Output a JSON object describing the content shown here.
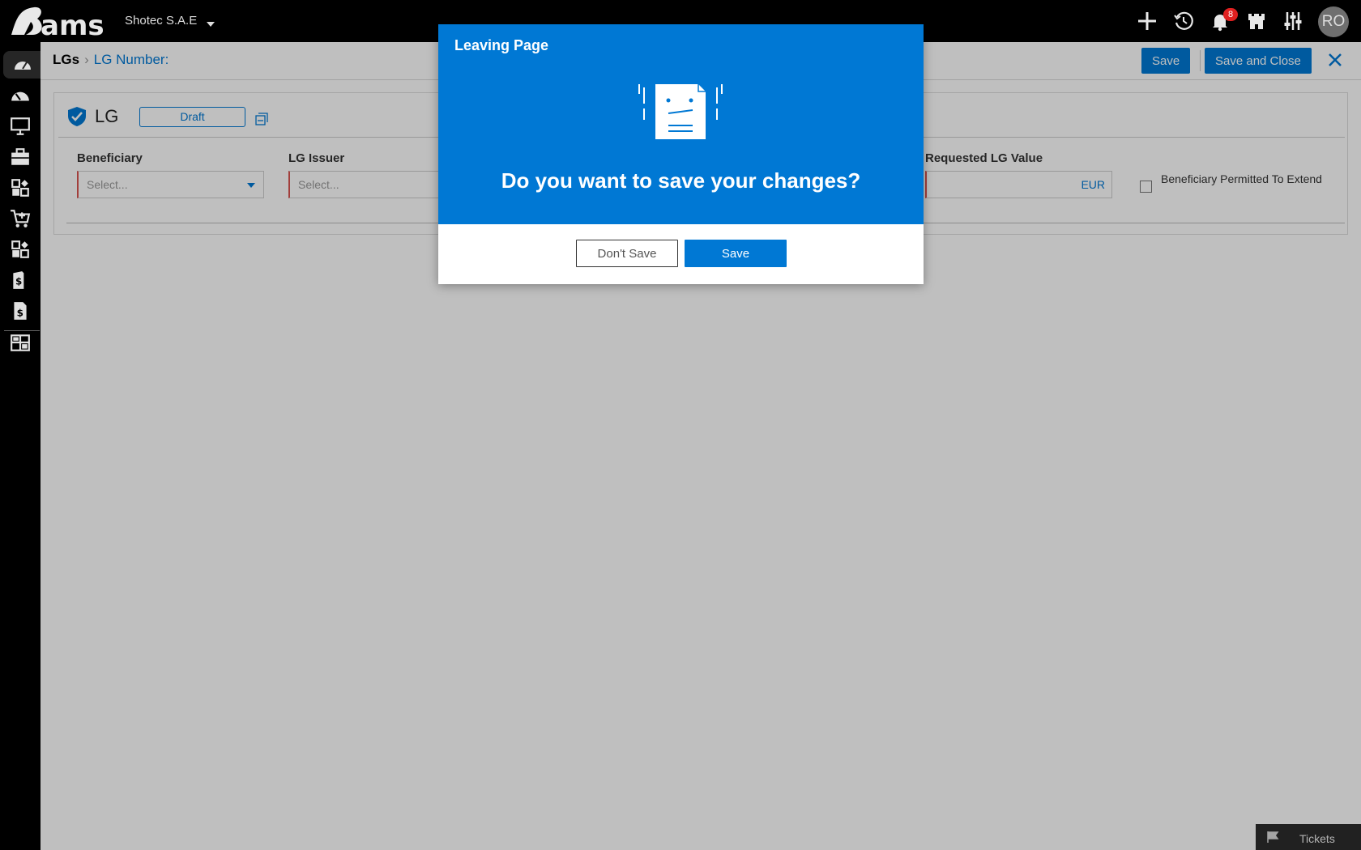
{
  "topbar": {
    "logo_text": "Rams",
    "company": "Shotec S.A.E",
    "notification_count": "8",
    "avatar_initials": "RO"
  },
  "breadcrumb": {
    "root": "LGs",
    "current": "LG Number:"
  },
  "toolbar": {
    "save_label": "Save",
    "save_close_label": "Save and Close"
  },
  "form": {
    "title": "LG",
    "status": "Draft",
    "fields": {
      "beneficiary": {
        "label": "Beneficiary",
        "placeholder": "Select..."
      },
      "issuer": {
        "label": "LG Issuer",
        "placeholder": "Select..."
      },
      "requested_value": {
        "label": "Requested LG Value",
        "currency": "EUR"
      }
    },
    "checkbox_label": "Beneficiary Permitted To Extend"
  },
  "tickets_label": "Tickets",
  "modal": {
    "title": "Leaving Page",
    "question": "Do you want to save your changes?",
    "dont_save_label": "Don't Save",
    "save_label": "Save"
  },
  "colors": {
    "accent": "#0078d4",
    "topbar": "#000000",
    "required": "#d9534f"
  }
}
